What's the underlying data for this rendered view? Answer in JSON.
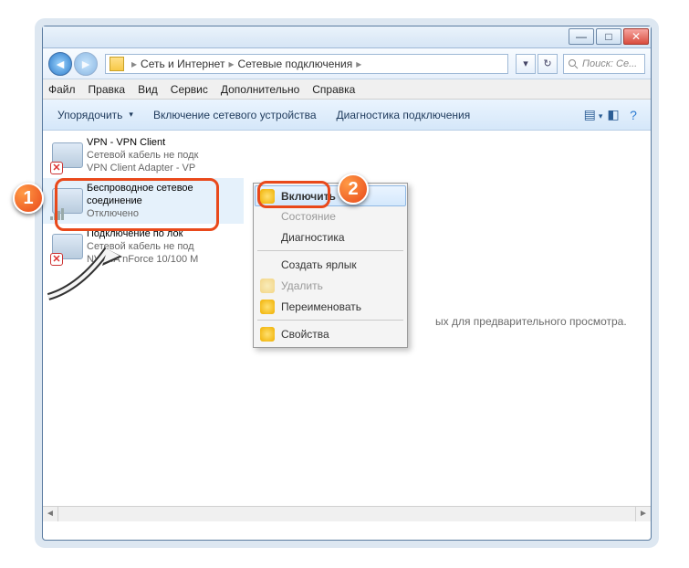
{
  "titlebar": {
    "min": "—",
    "max": "□",
    "close": "✕"
  },
  "breadcrumb": {
    "seg1": "Сеть и Интернет",
    "seg2": "Сетевые подключения",
    "sep": "▸"
  },
  "search": {
    "placeholder": "Поиск: Се..."
  },
  "menu": {
    "file": "Файл",
    "edit": "Правка",
    "view": "Вид",
    "tools": "Сервис",
    "extra": "Дополнительно",
    "help": "Справка"
  },
  "toolbar": {
    "organize": "Упорядочить",
    "enable": "Включение сетевого устройства",
    "diag": "Диагностика подключения"
  },
  "items": [
    {
      "title": "VPN - VPN Client",
      "sub1": "Сетевой кабель не подк",
      "sub2": "VPN Client Adapter - VP"
    },
    {
      "title": "Беспроводное сетевое соединение",
      "sub1": "Отключено",
      "sub2": ""
    },
    {
      "title": "Подключение по лок",
      "sub1": "Сетевой кабель не под",
      "sub2": "NVIDIA nForce 10/100 M"
    }
  ],
  "ctx": {
    "enable": "Включить",
    "status": "Состояние",
    "diag": "Диагностика",
    "shortcut": "Создать ярлык",
    "delete": "Удалить",
    "rename": "Переименовать",
    "props": "Свойства"
  },
  "preview_tail": "ых для предварительного просмотра.",
  "markers": {
    "one": "1",
    "two": "2"
  }
}
